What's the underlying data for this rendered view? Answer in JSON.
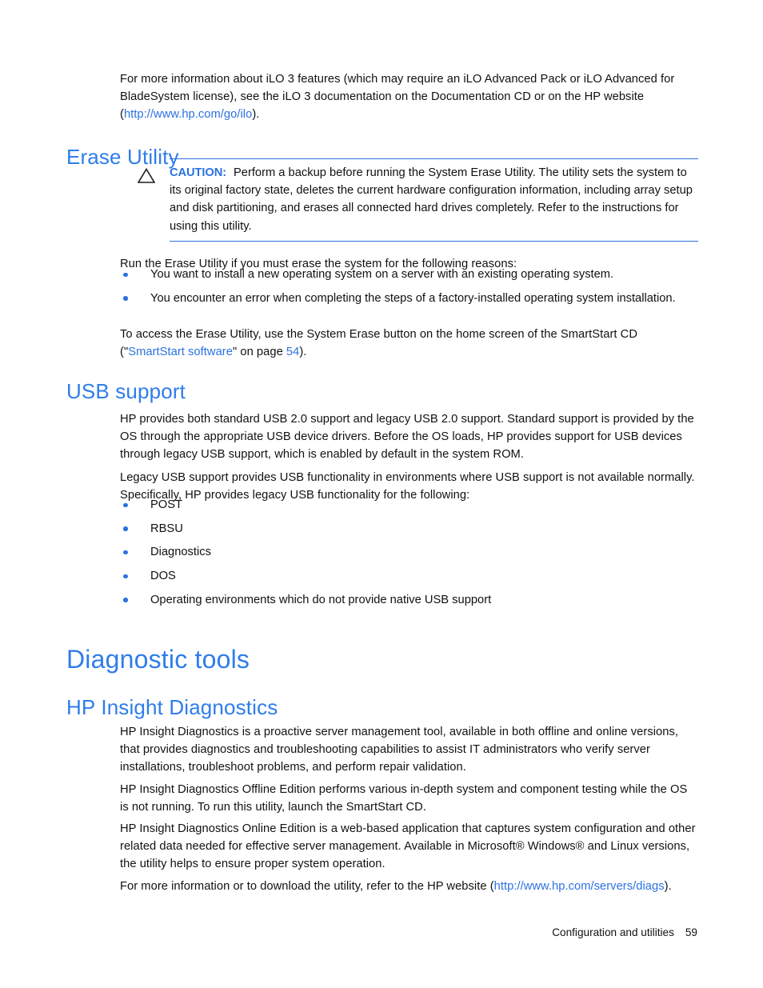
{
  "document": {
    "intro_paragraph": {
      "before_link": "For more information about iLO 3 features (which may require an iLO Advanced Pack or iLO Advanced for BladeSystem license), see the iLO 3 documentation on the Documentation CD or on the HP website (",
      "link": "http://www.hp.com/go/ilo",
      "after_link": ")."
    },
    "erase_utility": {
      "heading": "Erase Utility",
      "caution": {
        "icon": "warning-triangle-icon",
        "label": "CAUTION:",
        "text": "Perform a backup before running the System Erase Utility. The utility sets the system to its original factory state, deletes the current hardware configuration information, including array setup and disk partitioning, and erases all connected hard drives completely. Refer to the instructions for using this utility."
      },
      "lead_in": "Run the Erase Utility if you must erase the system for the following reasons:",
      "bullets": [
        "You want to install a new operating system on a server with an existing operating system.",
        "You encounter an error when completing the steps of a factory-installed operating system installation."
      ],
      "closing": {
        "before_link": "To access the Erase Utility, use the System Erase button on the home screen of the SmartStart CD (\"",
        "link": "SmartStart software",
        "middle": "\" on page ",
        "page_link": "54",
        "after": ")."
      }
    },
    "usb_support": {
      "heading": "USB support",
      "paragraphs": [
        "HP provides both standard USB 2.0 support and legacy USB 2.0 support. Standard support is provided by the OS through the appropriate USB device drivers. Before the OS loads, HP provides support for USB devices through legacy USB support, which is enabled by default in the system ROM.",
        "Legacy USB support provides USB functionality in environments where USB support is not available normally. Specifically, HP provides legacy USB functionality for the following:"
      ],
      "bullets": [
        "POST",
        "RBSU",
        "Diagnostics",
        "DOS",
        "Operating environments which do not provide native USB support"
      ]
    },
    "diagnostic_tools": {
      "heading": "Diagnostic tools"
    },
    "hp_insight_diagnostics": {
      "heading": "HP Insight Diagnostics",
      "paragraphs": [
        "HP Insight Diagnostics is a proactive server management tool, available in both offline and online versions, that provides diagnostics and troubleshooting capabilities to assist IT administrators who verify server installations, troubleshoot problems, and perform repair validation.",
        "HP Insight Diagnostics Offline Edition performs various in-depth system and component testing while the OS is not running. To run this utility, launch the SmartStart CD.",
        "HP Insight Diagnostics Online Edition is a web-based application that captures system configuration and other related data needed for effective server management. Available in Microsoft® Windows® and Linux versions, the utility helps to ensure proper system operation."
      ],
      "closing": {
        "before_link": "For more information or to download the utility, refer to the HP website (",
        "link": "http://www.hp.com/servers/diags",
        "after_link": ")."
      }
    },
    "footer": {
      "chapter": "Configuration and utilities",
      "page_number": "59"
    },
    "colors": {
      "heading_blue": "#2F7DEB",
      "link_blue": "#2B72E0",
      "rule_blue": "#2B72E0",
      "body_black": "#111111"
    }
  }
}
